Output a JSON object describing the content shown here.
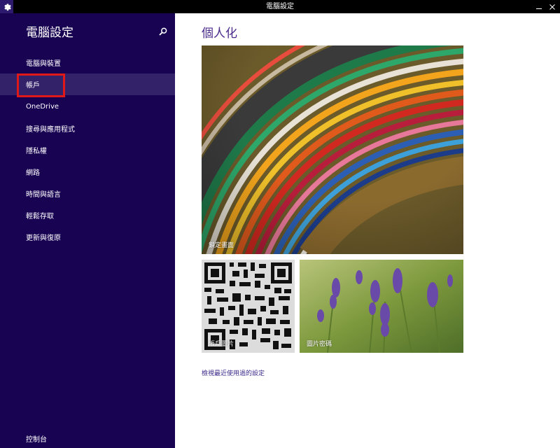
{
  "window": {
    "title": "電腦設定"
  },
  "sidebar": {
    "title": "電腦設定",
    "search_icon": "search-icon",
    "items": [
      {
        "label": "電腦與裝置"
      },
      {
        "label": "帳戶"
      },
      {
        "label": "OneDrive"
      },
      {
        "label": "搜尋與應用程式"
      },
      {
        "label": "隱私權"
      },
      {
        "label": "網路"
      },
      {
        "label": "時間與語言"
      },
      {
        "label": "輕鬆存取"
      },
      {
        "label": "更新與復原"
      }
    ],
    "selected": "帳戶",
    "footer_link": "控制台"
  },
  "main": {
    "title": "個人化",
    "tiles": {
      "lock_screen": {
        "label": "鎖定畫面"
      },
      "account_picture": {
        "label": "帳戶圖片"
      },
      "picture_password": {
        "label": "圖片密碼"
      }
    },
    "recent_settings_link": "檢視最近使用過的設定"
  },
  "colors": {
    "sidebar_bg": "#180353",
    "selected_item_bg": "#33216a",
    "highlight_border": "#e11818",
    "accent_text": "#4a2b8c"
  }
}
